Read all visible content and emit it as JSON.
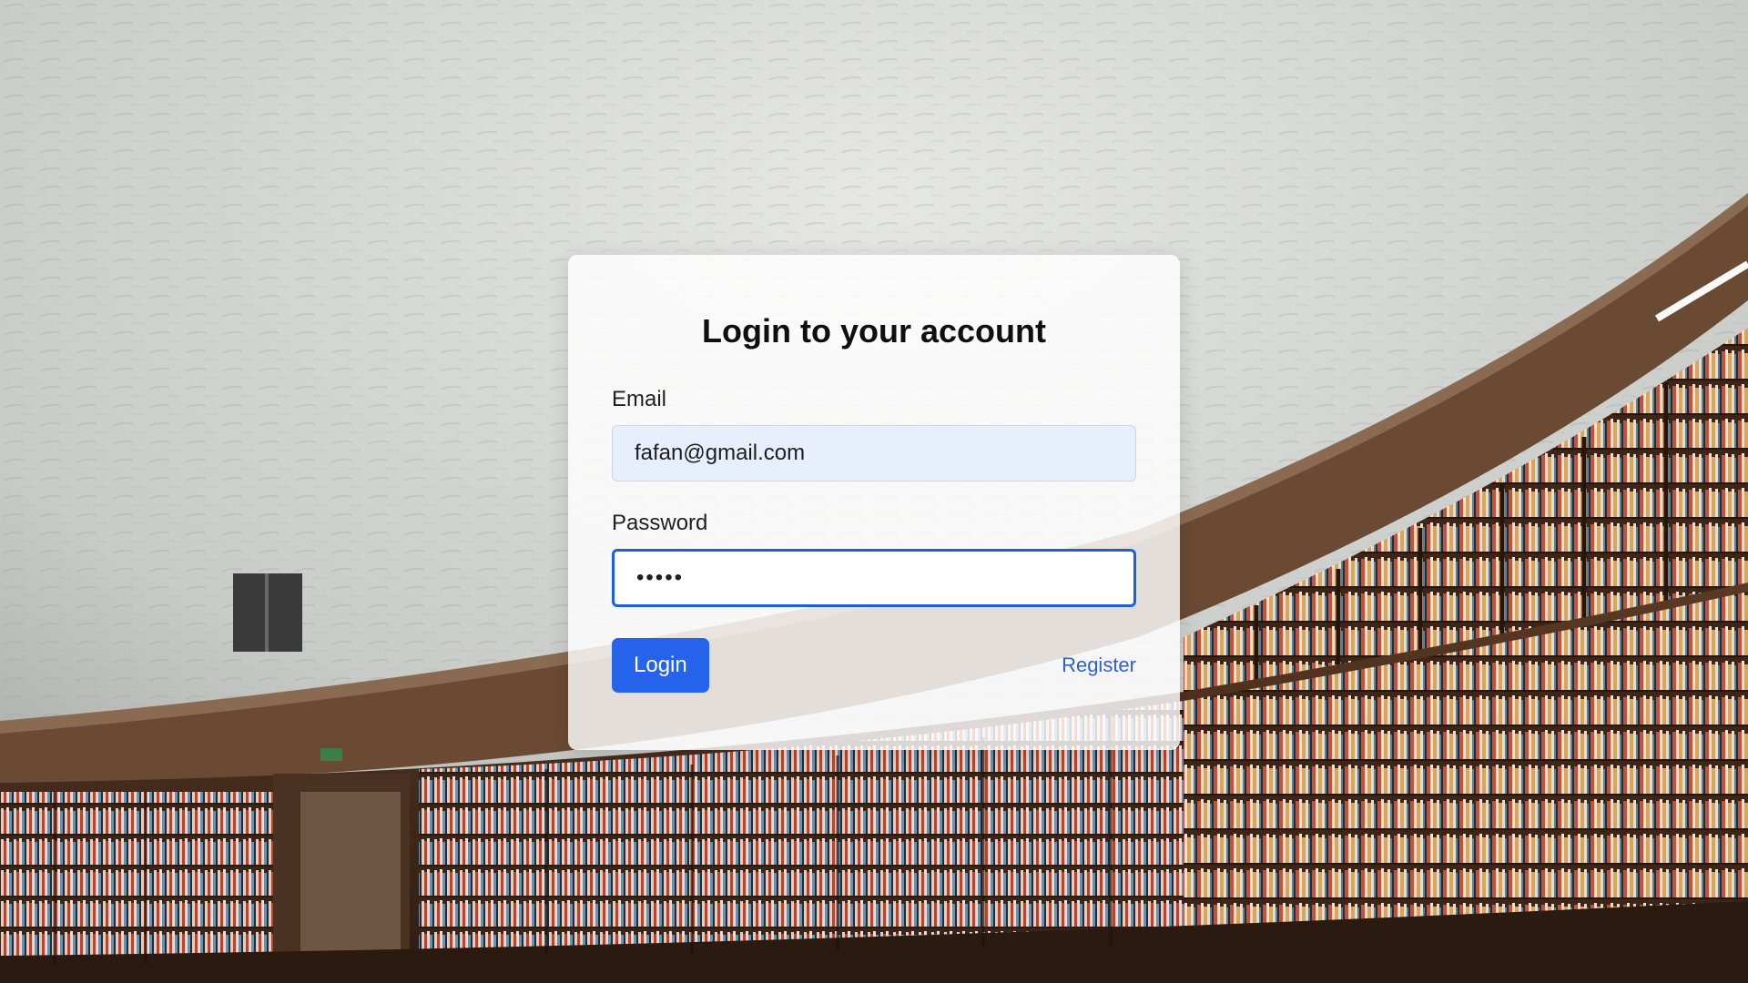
{
  "login": {
    "title": "Login to your account",
    "email_label": "Email",
    "email_value": "fafan@gmail.com",
    "password_label": "Password",
    "password_value": "•••••",
    "login_button": "Login",
    "register_link": "Register"
  },
  "colors": {
    "accent": "#2563eb",
    "focus_border": "#1f5fd6",
    "email_field_bg": "#e8effc"
  }
}
